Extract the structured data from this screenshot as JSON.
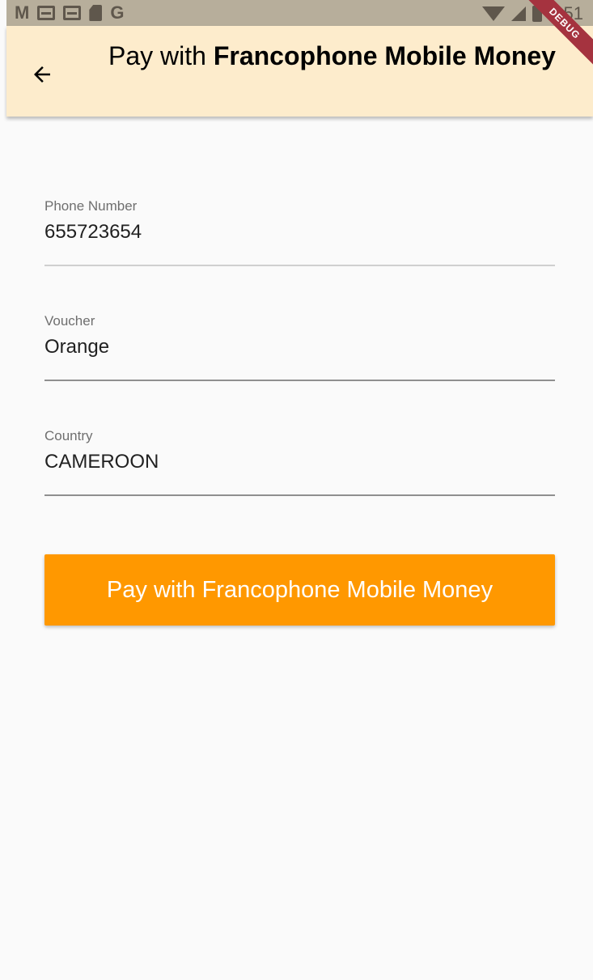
{
  "status_bar": {
    "left_icons": [
      "gmail-icon",
      "calendar-icon",
      "calendar-icon",
      "sd-card-icon",
      "google-icon"
    ],
    "time": "4:51"
  },
  "app_bar": {
    "title_prefix": "Pay with ",
    "title_bold": "Francophone Mobile Money",
    "background": "#fdeccc",
    "debug_banner": "DEBUG"
  },
  "form": {
    "phone": {
      "label": "Phone Number",
      "value": "655723654"
    },
    "voucher": {
      "label": "Voucher",
      "value": "Orange"
    },
    "country": {
      "label": "Country",
      "value": "CAMEROON"
    }
  },
  "actions": {
    "pay_label": "Pay with Francophone Mobile Money",
    "pay_color": "#ff9800"
  }
}
